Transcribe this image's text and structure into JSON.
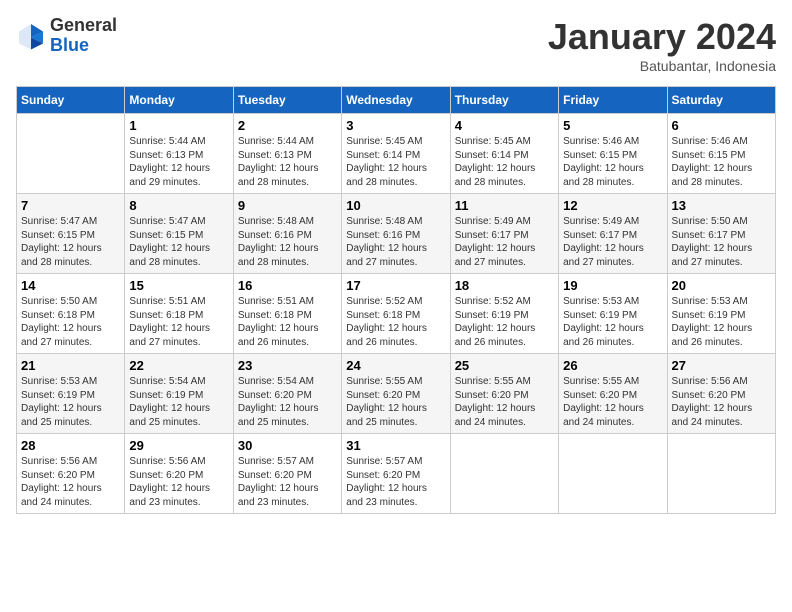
{
  "header": {
    "logo_general": "General",
    "logo_blue": "Blue",
    "month": "January 2024",
    "location": "Batubantar, Indonesia"
  },
  "weekdays": [
    "Sunday",
    "Monday",
    "Tuesday",
    "Wednesday",
    "Thursday",
    "Friday",
    "Saturday"
  ],
  "weeks": [
    [
      {
        "day": "",
        "info": ""
      },
      {
        "day": "1",
        "info": "Sunrise: 5:44 AM\nSunset: 6:13 PM\nDaylight: 12 hours\nand 29 minutes."
      },
      {
        "day": "2",
        "info": "Sunrise: 5:44 AM\nSunset: 6:13 PM\nDaylight: 12 hours\nand 28 minutes."
      },
      {
        "day": "3",
        "info": "Sunrise: 5:45 AM\nSunset: 6:14 PM\nDaylight: 12 hours\nand 28 minutes."
      },
      {
        "day": "4",
        "info": "Sunrise: 5:45 AM\nSunset: 6:14 PM\nDaylight: 12 hours\nand 28 minutes."
      },
      {
        "day": "5",
        "info": "Sunrise: 5:46 AM\nSunset: 6:15 PM\nDaylight: 12 hours\nand 28 minutes."
      },
      {
        "day": "6",
        "info": "Sunrise: 5:46 AM\nSunset: 6:15 PM\nDaylight: 12 hours\nand 28 minutes."
      }
    ],
    [
      {
        "day": "7",
        "info": "Sunrise: 5:47 AM\nSunset: 6:15 PM\nDaylight: 12 hours\nand 28 minutes."
      },
      {
        "day": "8",
        "info": "Sunrise: 5:47 AM\nSunset: 6:15 PM\nDaylight: 12 hours\nand 28 minutes."
      },
      {
        "day": "9",
        "info": "Sunrise: 5:48 AM\nSunset: 6:16 PM\nDaylight: 12 hours\nand 28 minutes."
      },
      {
        "day": "10",
        "info": "Sunrise: 5:48 AM\nSunset: 6:16 PM\nDaylight: 12 hours\nand 27 minutes."
      },
      {
        "day": "11",
        "info": "Sunrise: 5:49 AM\nSunset: 6:17 PM\nDaylight: 12 hours\nand 27 minutes."
      },
      {
        "day": "12",
        "info": "Sunrise: 5:49 AM\nSunset: 6:17 PM\nDaylight: 12 hours\nand 27 minutes."
      },
      {
        "day": "13",
        "info": "Sunrise: 5:50 AM\nSunset: 6:17 PM\nDaylight: 12 hours\nand 27 minutes."
      }
    ],
    [
      {
        "day": "14",
        "info": "Sunrise: 5:50 AM\nSunset: 6:18 PM\nDaylight: 12 hours\nand 27 minutes."
      },
      {
        "day": "15",
        "info": "Sunrise: 5:51 AM\nSunset: 6:18 PM\nDaylight: 12 hours\nand 27 minutes."
      },
      {
        "day": "16",
        "info": "Sunrise: 5:51 AM\nSunset: 6:18 PM\nDaylight: 12 hours\nand 26 minutes."
      },
      {
        "day": "17",
        "info": "Sunrise: 5:52 AM\nSunset: 6:18 PM\nDaylight: 12 hours\nand 26 minutes."
      },
      {
        "day": "18",
        "info": "Sunrise: 5:52 AM\nSunset: 6:19 PM\nDaylight: 12 hours\nand 26 minutes."
      },
      {
        "day": "19",
        "info": "Sunrise: 5:53 AM\nSunset: 6:19 PM\nDaylight: 12 hours\nand 26 minutes."
      },
      {
        "day": "20",
        "info": "Sunrise: 5:53 AM\nSunset: 6:19 PM\nDaylight: 12 hours\nand 26 minutes."
      }
    ],
    [
      {
        "day": "21",
        "info": "Sunrise: 5:53 AM\nSunset: 6:19 PM\nDaylight: 12 hours\nand 25 minutes."
      },
      {
        "day": "22",
        "info": "Sunrise: 5:54 AM\nSunset: 6:19 PM\nDaylight: 12 hours\nand 25 minutes."
      },
      {
        "day": "23",
        "info": "Sunrise: 5:54 AM\nSunset: 6:20 PM\nDaylight: 12 hours\nand 25 minutes."
      },
      {
        "day": "24",
        "info": "Sunrise: 5:55 AM\nSunset: 6:20 PM\nDaylight: 12 hours\nand 25 minutes."
      },
      {
        "day": "25",
        "info": "Sunrise: 5:55 AM\nSunset: 6:20 PM\nDaylight: 12 hours\nand 24 minutes."
      },
      {
        "day": "26",
        "info": "Sunrise: 5:55 AM\nSunset: 6:20 PM\nDaylight: 12 hours\nand 24 minutes."
      },
      {
        "day": "27",
        "info": "Sunrise: 5:56 AM\nSunset: 6:20 PM\nDaylight: 12 hours\nand 24 minutes."
      }
    ],
    [
      {
        "day": "28",
        "info": "Sunrise: 5:56 AM\nSunset: 6:20 PM\nDaylight: 12 hours\nand 24 minutes."
      },
      {
        "day": "29",
        "info": "Sunrise: 5:56 AM\nSunset: 6:20 PM\nDaylight: 12 hours\nand 23 minutes."
      },
      {
        "day": "30",
        "info": "Sunrise: 5:57 AM\nSunset: 6:20 PM\nDaylight: 12 hours\nand 23 minutes."
      },
      {
        "day": "31",
        "info": "Sunrise: 5:57 AM\nSunset: 6:20 PM\nDaylight: 12 hours\nand 23 minutes."
      },
      {
        "day": "",
        "info": ""
      },
      {
        "day": "",
        "info": ""
      },
      {
        "day": "",
        "info": ""
      }
    ]
  ]
}
